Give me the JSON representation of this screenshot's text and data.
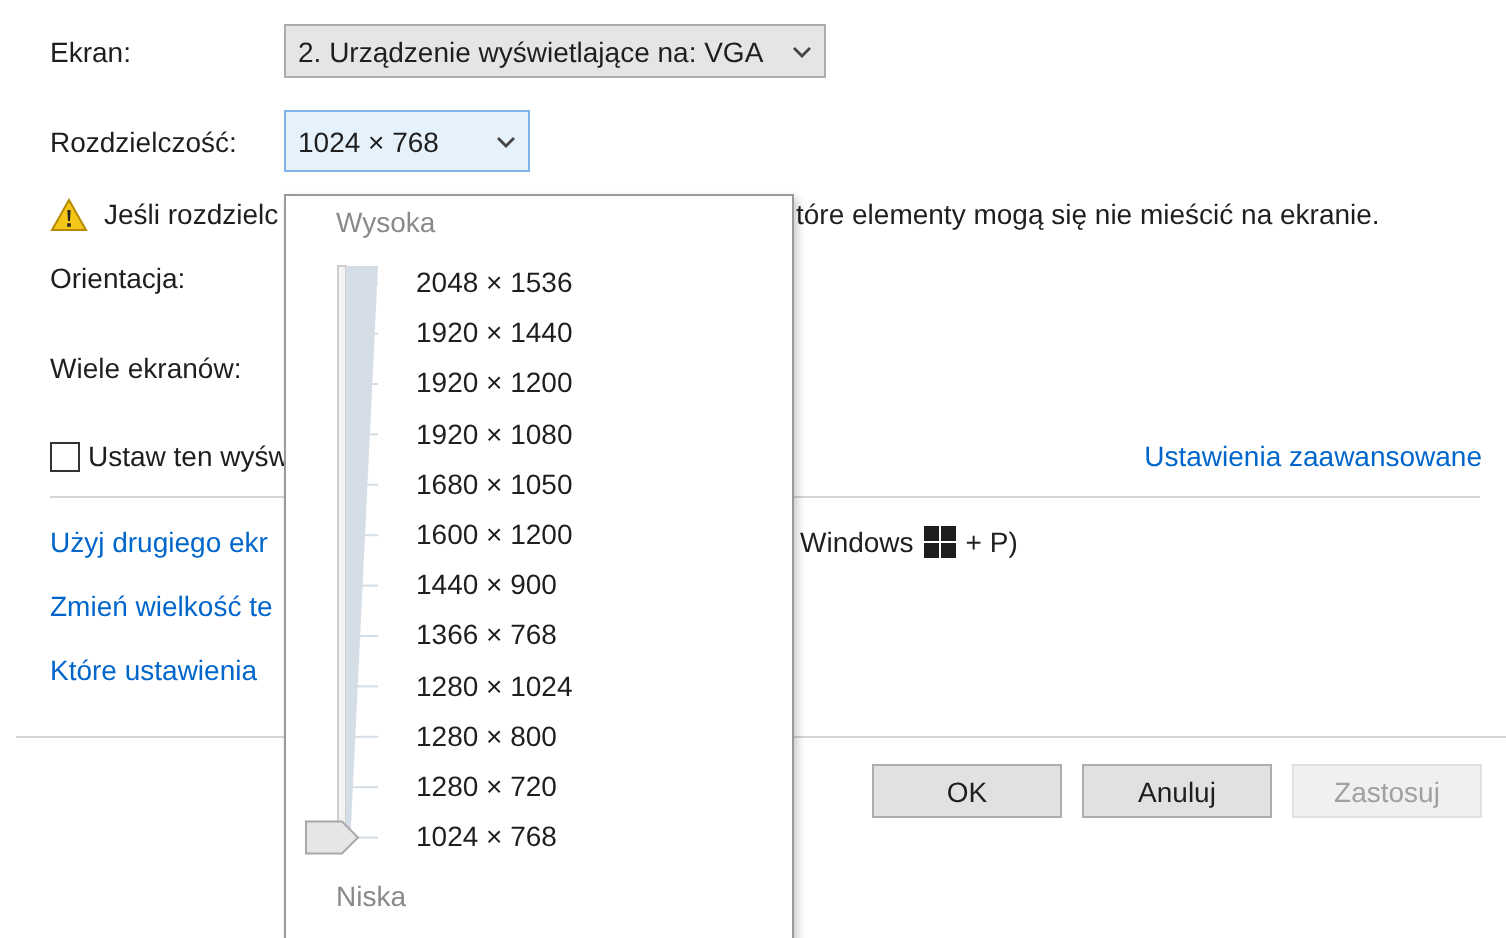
{
  "screen": {
    "label": "Ekran:",
    "value": "2. Urządzenie wyświetlające na: VGA"
  },
  "resolution": {
    "label": "Rozdzielczość:",
    "value": "1024 × 768",
    "expanded": true
  },
  "warning": {
    "text_left": "Jeśli rozdzielc",
    "text_right": "tóre elementy mogą się nie mieścić na ekranie."
  },
  "orientation": {
    "label": "Orientacja:"
  },
  "multiple_displays": {
    "label": "Wiele ekranów:"
  },
  "main_display": {
    "label": "Ustaw ten wyśw",
    "checked": false
  },
  "advanced_link": "Ustawienia zaawansowane",
  "links": [
    {
      "text": "Użyj drugiego ekr",
      "hint_before": "Windows",
      "hint_after": "+ P)"
    },
    {
      "text": "Zmień wielkość te"
    },
    {
      "text": "Które ustawienia"
    }
  ],
  "buttons": [
    {
      "label": "OK",
      "disabled": false
    },
    {
      "label": "Anuluj",
      "disabled": false
    },
    {
      "label": "Zastosuj",
      "disabled": true
    }
  ],
  "resolution_popup": {
    "high_label": "Wysoka",
    "low_label": "Niska",
    "items": [
      {
        "label": "2048 × 1536",
        "selected": false
      },
      {
        "label": "1920 × 1440",
        "selected": false
      },
      {
        "label": "1920 × 1200",
        "selected": false
      },
      {
        "label": "1920 × 1080",
        "selected": false
      },
      {
        "label": "1680 × 1050",
        "selected": false
      },
      {
        "label": "1600 × 1200",
        "selected": false
      },
      {
        "label": "1440 × 900",
        "selected": false
      },
      {
        "label": "1366 × 768",
        "selected": false
      },
      {
        "label": "1280 × 1024",
        "selected": false
      },
      {
        "label": "1280 × 800",
        "selected": false
      },
      {
        "label": "1280 × 720",
        "selected": false
      },
      {
        "label": "1024 × 768",
        "selected": true
      }
    ]
  }
}
